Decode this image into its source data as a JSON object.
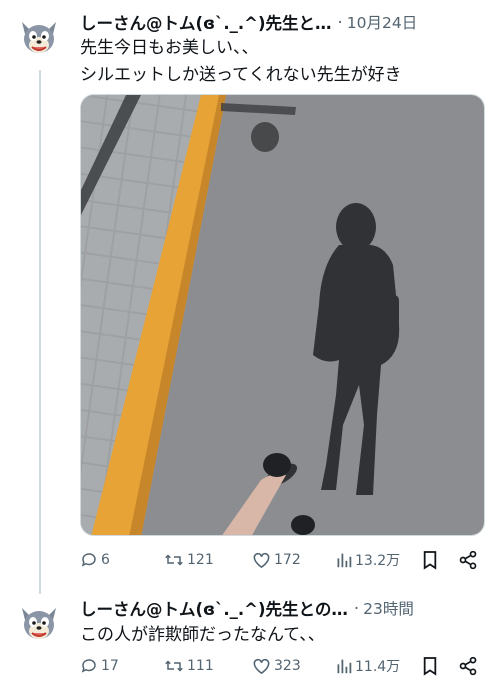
{
  "tweets": [
    {
      "display_name": "しーさん@トム(ɞ`._.^)先生と…",
      "timestamp": "10月24日",
      "text_lines": [
        "先生今日もお美しい、、",
        "シルエットしか送ってくれない先生が好き"
      ],
      "actions": {
        "replies": "6",
        "retweets": "121",
        "likes": "172",
        "views": "13.2万"
      },
      "icons": [
        "reply-icon",
        "retweet-icon",
        "like-icon",
        "views-icon",
        "bookmark-icon",
        "share-icon"
      ]
    },
    {
      "display_name": "しーさん@トム(ɞ`._.^)先生との…",
      "timestamp": "23時間",
      "text_lines": [
        "この人が詐欺師だったなんて、、"
      ],
      "actions": {
        "replies": "17",
        "retweets": "111",
        "likes": "323",
        "views": "11.4万"
      },
      "icons": [
        "reply-icon",
        "retweet-icon",
        "like-icon",
        "views-icon",
        "bookmark-icon",
        "share-icon"
      ]
    }
  ],
  "colors": {
    "text": "#0f1419",
    "secondary": "#536471",
    "thread_line": "#cfd9de",
    "curb_orange": "#e8a336"
  },
  "separator": "·"
}
